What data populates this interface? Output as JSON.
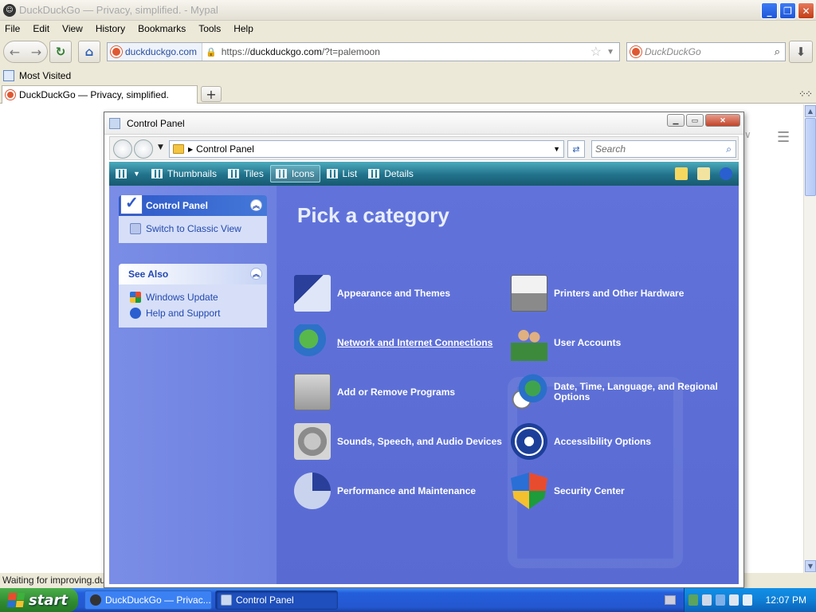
{
  "browser": {
    "window_title": "DuckDuckGo — Privacy, simplified. - Mypal",
    "menu": [
      "File",
      "Edit",
      "View",
      "History",
      "Bookmarks",
      "Tools",
      "Help"
    ],
    "url_domain": "duckduckgo.com",
    "url_prefix": "https://",
    "url_host": "duckduckgo.com",
    "url_path": "/?t=palemoon",
    "search_placeholder": "DuckDuckGo",
    "bookmarks": {
      "most_visited": "Most Visited"
    },
    "tab_title": "DuckDuckGo — Privacy, simplified.",
    "status_text": "Waiting for improving.duckduckgo.com..."
  },
  "control_panel": {
    "title": "Control Panel",
    "address": "Control Panel",
    "search_placeholder": "Search",
    "toolbar": [
      "Thumbnails",
      "Tiles",
      "Icons",
      "List",
      "Details"
    ],
    "active_view": "Icons",
    "sidebar": {
      "panel1_title": "Control Panel",
      "switch_link": "Switch to Classic View",
      "see_also_title": "See Also",
      "see_also_items": [
        "Windows Update",
        "Help and Support"
      ]
    },
    "heading": "Pick a category",
    "categories": [
      {
        "label": "Appearance and Themes",
        "icon": "appearance-icon"
      },
      {
        "label": "Printers and Other Hardware",
        "icon": "printer-icon"
      },
      {
        "label": "Network and Internet Connections",
        "icon": "network-icon",
        "underlined": true
      },
      {
        "label": "User Accounts",
        "icon": "users-icon"
      },
      {
        "label": "Add or Remove Programs",
        "icon": "add-remove-icon"
      },
      {
        "label": "Date, Time, Language, and Regional Options",
        "icon": "date-time-icon"
      },
      {
        "label": "Sounds, Speech, and Audio Devices",
        "icon": "sound-icon"
      },
      {
        "label": "Accessibility Options",
        "icon": "accessibility-icon"
      },
      {
        "label": "Performance and Maintenance",
        "icon": "performance-icon"
      },
      {
        "label": "Security Center",
        "icon": "security-icon"
      }
    ]
  },
  "taskbar": {
    "start_label": "start",
    "items": [
      "DuckDuckGo — Privac...",
      "Control Panel"
    ],
    "clock": "12:07 PM"
  },
  "colors": {
    "taskbar_blue": "#245edb",
    "start_green": "#2f8a2f",
    "category_bg": "#5c6fd6",
    "toolbar_teal": "#21728b"
  }
}
